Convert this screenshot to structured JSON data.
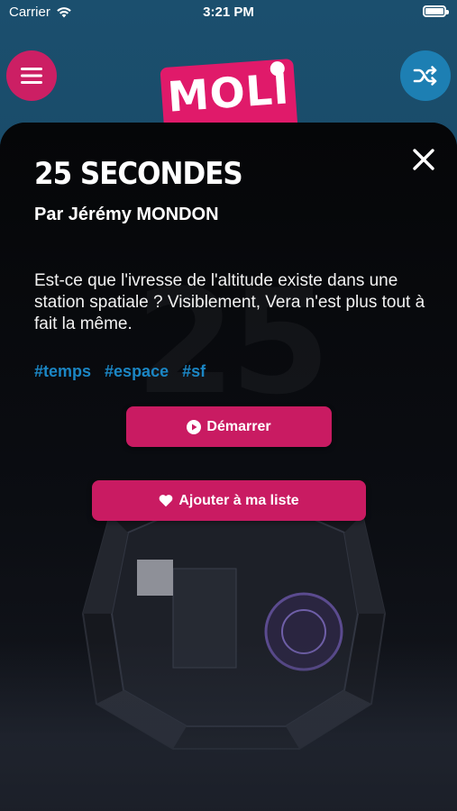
{
  "status_bar": {
    "carrier": "Carrier",
    "time": "3:21 PM"
  },
  "header": {
    "logo_text": "MOLI"
  },
  "story": {
    "title": "25 SECONDES",
    "author": "Par Jérémy MONDON",
    "description": "Est-ce que l'ivresse de l'altitude existe dans une station spatiale ? Visiblement, Vera n'est plus tout à fait la même.",
    "tags": [
      "#temps",
      "#espace",
      "#sf"
    ],
    "cover_number": "25"
  },
  "actions": {
    "start_label": "Démarrer",
    "add_label": "Ajouter à ma liste"
  },
  "colors": {
    "accent_pink": "#c91b62",
    "accent_blue": "#1d7fb3",
    "tag_blue": "#1b86c4"
  }
}
